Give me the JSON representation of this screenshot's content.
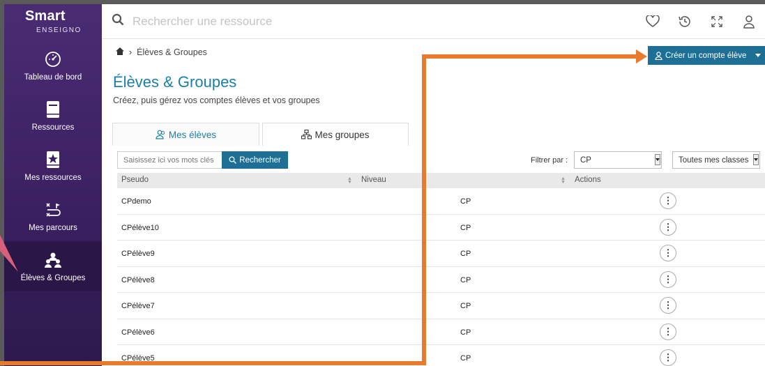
{
  "sidebar": {
    "logo_brand": "Smart",
    "logo_sub": "ENSEIGNO",
    "items": [
      {
        "label": "Tableau de bord",
        "icon": "dashboard-gauge-icon"
      },
      {
        "label": "Ressources",
        "icon": "book-icon"
      },
      {
        "label": "Mes ressources",
        "icon": "star-book-icon"
      },
      {
        "label": "Mes parcours",
        "icon": "route-icon"
      },
      {
        "label": "Élèves & Groupes",
        "icon": "users-group-icon",
        "active": true
      }
    ]
  },
  "topbar": {
    "search_placeholder": "Rechercher une ressource",
    "icons": [
      "heart-icon",
      "history-icon",
      "fullscreen-icon",
      "user-icon"
    ]
  },
  "breadcrumb": {
    "current": "Élèves & Groupes"
  },
  "page": {
    "title": "Élèves & Groupes",
    "subtitle": "Créez, puis gérez vos comptes élèves et vos groupes",
    "create_button": "Créer un compte élève"
  },
  "tabs": [
    {
      "label": "Mes élèves",
      "active": true
    },
    {
      "label": "Mes groupes",
      "active": false
    }
  ],
  "filters": {
    "search_placeholder": "Saisissez ici vos mots clés",
    "search_button": "Rechercher",
    "filter_label": "Filtrer par :",
    "niveau_value": "CP",
    "classes_value": "Toutes mes classes"
  },
  "table": {
    "headers": [
      "Pseudo",
      "Niveau",
      "Actions"
    ],
    "rows": [
      {
        "pseudo": "CPdemo",
        "niveau": "CP"
      },
      {
        "pseudo": "CPélève10",
        "niveau": "CP"
      },
      {
        "pseudo": "CPélève9",
        "niveau": "CP"
      },
      {
        "pseudo": "CPélève8",
        "niveau": "CP"
      },
      {
        "pseudo": "CPélève7",
        "niveau": "CP"
      },
      {
        "pseudo": "CPélève6",
        "niveau": "CP"
      },
      {
        "pseudo": "CPélève5",
        "niveau": "CP"
      }
    ],
    "action_glyph": "⋮"
  },
  "colors": {
    "accent": "#1d6f96",
    "title": "#1a7fa8",
    "sidebar": "#3a1f60",
    "annotation_orange": "#e87a2e",
    "annotation_pink": "#d9607a"
  }
}
